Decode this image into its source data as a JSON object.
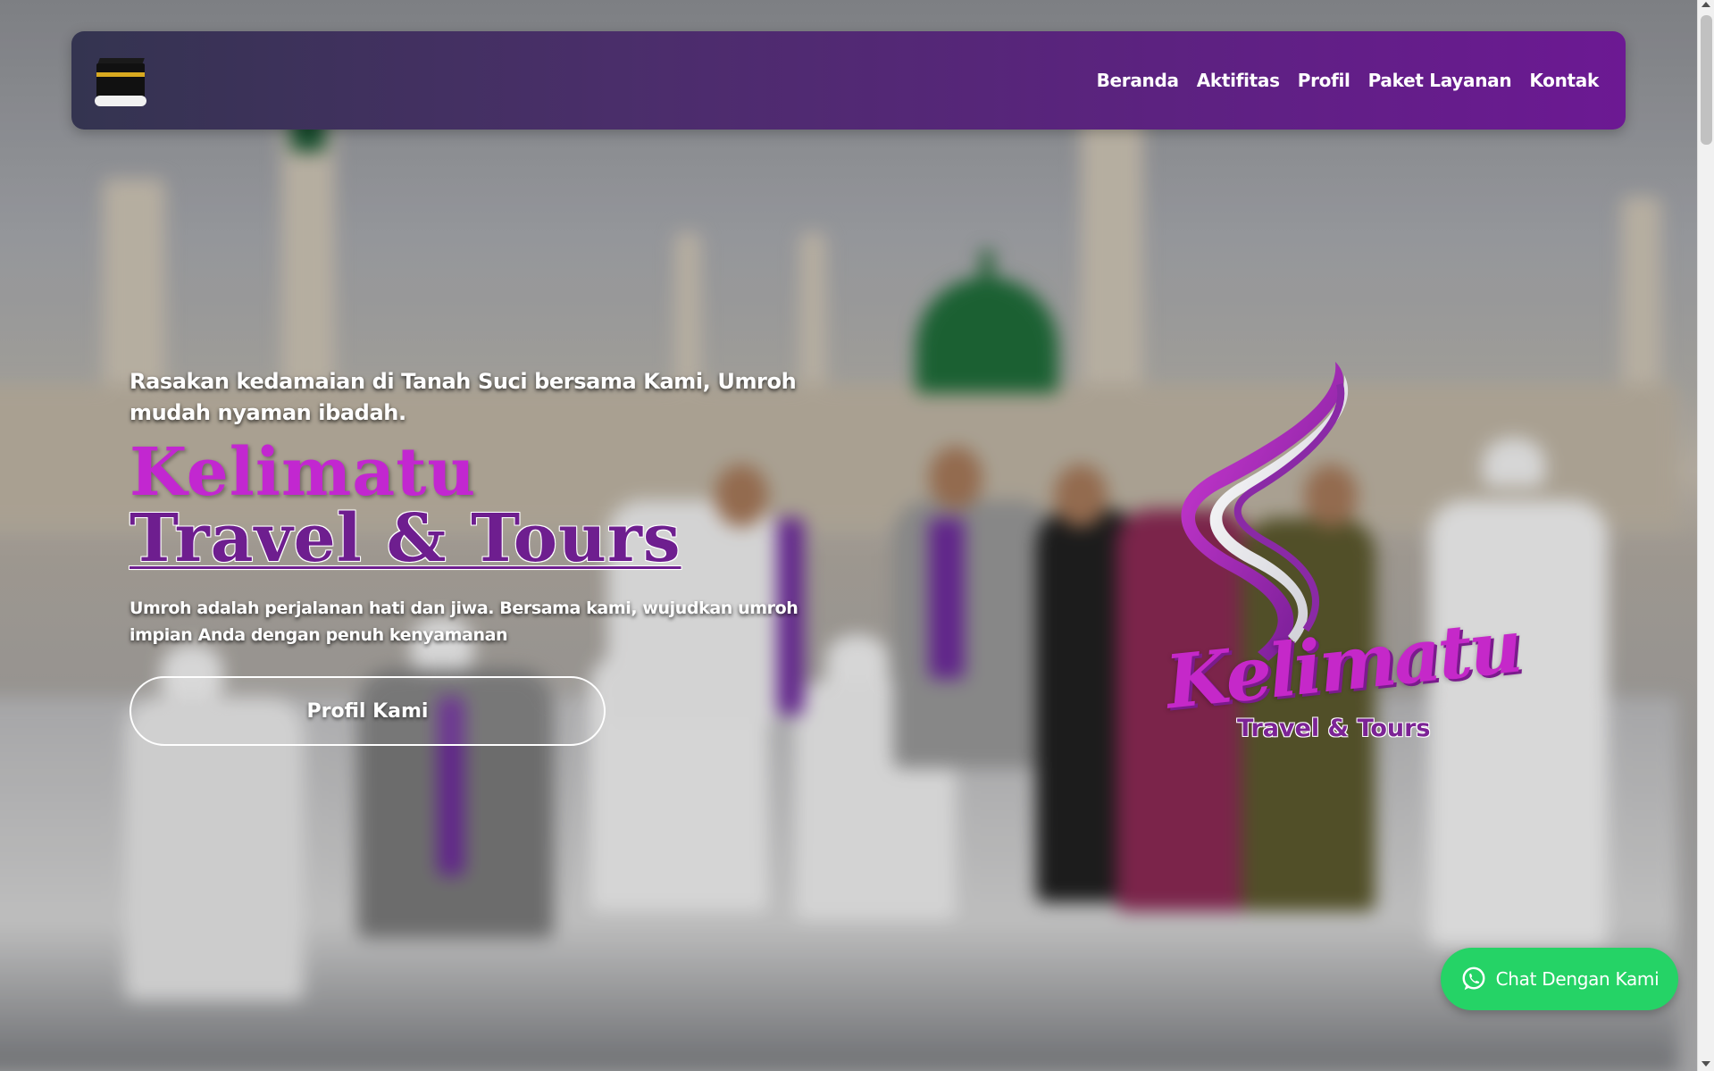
{
  "navbar": {
    "logo_icon": "kaaba-icon",
    "links": [
      {
        "label": "Beranda"
      },
      {
        "label": "Aktifitas"
      },
      {
        "label": "Profil"
      },
      {
        "label": "Paket Layanan"
      },
      {
        "label": "Kontak"
      }
    ]
  },
  "hero": {
    "tagline": "Rasakan kedamaian di Tanah Suci bersama Kami, Umroh mudah nyaman ibadah.",
    "title_line1": "Kelimatu",
    "title_line2": "Travel & Tours",
    "subtitle": "Umroh adalah perjalanan hati dan jiwa. Bersama kami, wujudkan umroh impian Anda dengan penuh kenyamanan",
    "cta_label": "Profil Kami"
  },
  "brand_logo": {
    "script_text": "Kelimatu",
    "sub_text": "Travel & Tours"
  },
  "chat": {
    "icon": "whatsapp-icon",
    "label": "Chat Dengan Kami"
  },
  "colors": {
    "navbar_start": "#343450",
    "navbar_end": "#6c1993",
    "brand_magenta": "#c227d0",
    "brand_purple": "#6e1e8f",
    "whatsapp_green": "#25d366"
  }
}
